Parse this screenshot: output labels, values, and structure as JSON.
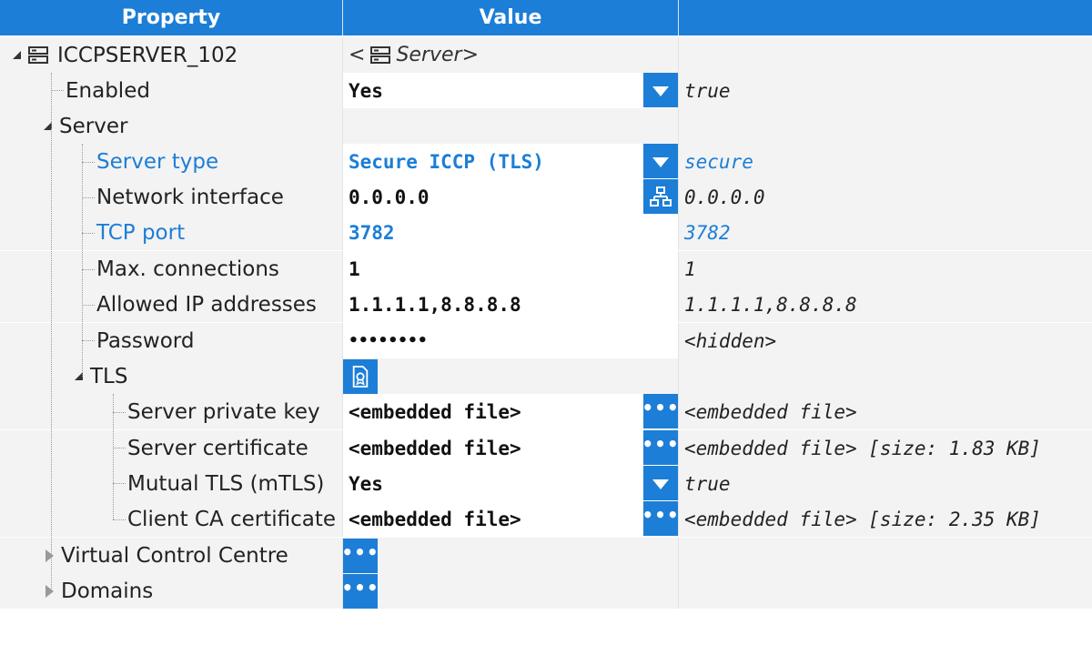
{
  "header": {
    "property": "Property",
    "value": "Value",
    "raw": ""
  },
  "rows": [
    {
      "label": "ICCPSERVER_102",
      "value_prefix": "<",
      "value": "Server>",
      "raw": ""
    },
    {
      "label": "Enabled",
      "value": "Yes",
      "raw": "true"
    },
    {
      "label": "Server",
      "value": "",
      "raw": ""
    },
    {
      "label": "Server type",
      "value": "Secure ICCP (TLS)",
      "raw": "secure"
    },
    {
      "label": "Network interface",
      "value": "0.0.0.0",
      "raw": "0.0.0.0"
    },
    {
      "label": "TCP port",
      "value": "3782",
      "raw": "3782"
    },
    {
      "label": "Max. connections",
      "value": "1",
      "raw": "1"
    },
    {
      "label": "Allowed IP addresses",
      "value": "1.1.1.1,8.8.8.8",
      "raw": "1.1.1.1,8.8.8.8"
    },
    {
      "label": "Password",
      "value": "••••••••",
      "raw": "<hidden>"
    },
    {
      "label": "TLS",
      "value": "",
      "raw": ""
    },
    {
      "label": "Server private key",
      "value": "<embedded file>",
      "raw": "<embedded file>"
    },
    {
      "label": "Server certificate",
      "value": "<embedded file>",
      "raw": "<embedded file> [size: 1.83 KB]"
    },
    {
      "label": "Mutual TLS (mTLS)",
      "value": "Yes",
      "raw": "true"
    },
    {
      "label": "Client CA certificate",
      "value": "<embedded file>",
      "raw": "<embedded file> [size: 2.35 KB]"
    },
    {
      "label": "Virtual Control Centre",
      "value": "",
      "raw": ""
    },
    {
      "label": "Domains",
      "value": "",
      "raw": ""
    }
  ],
  "button_glyphs": {
    "dots": "•••"
  },
  "colors": {
    "accent": "#1c7ed6",
    "row_bg": "#f3f3f3",
    "edit_bg": "#ffffff"
  }
}
